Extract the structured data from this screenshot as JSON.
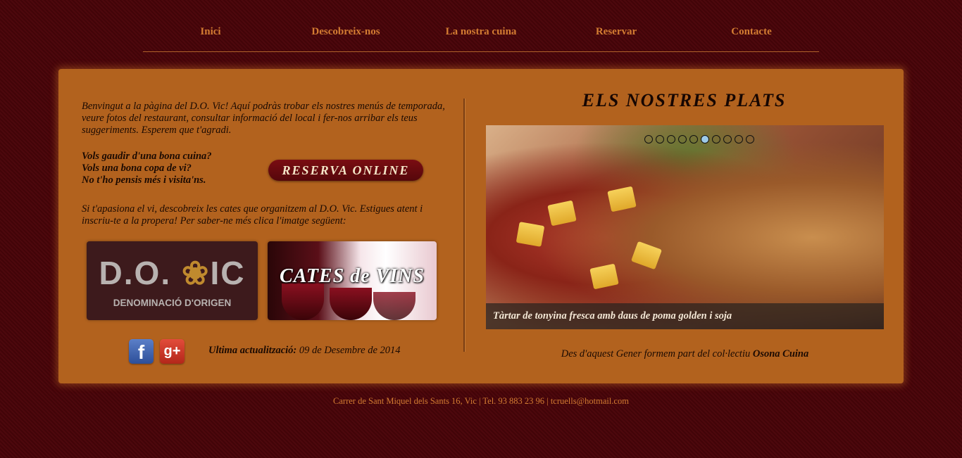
{
  "nav": {
    "items": [
      "Inici",
      "Descobreix-nos",
      "La nostra cuina",
      "Reservar",
      "Contacte"
    ]
  },
  "intro": {
    "text": "Benvingut a la pàgina del D.O. Vic! Aquí podràs trobar els nostres menús de temporada, veure fotos del restaurant, consultar informació del local i fer-nos arribar els teus suggeriments. Esperem que t'agradi."
  },
  "questions": {
    "line1": "Vols gaudir d'una bona cuina?",
    "line2": "Vols una bona copa de vi?",
    "line3": "No t'ho pensis més i visita'ns."
  },
  "reserva_button": {
    "label": "RESERVA ONLINE"
  },
  "cates": {
    "text": "Si t'apasiona el vi, descobreix les cates que organitzem al D.O. Vic. Estigues atent i inscriu-te a la propera! Per saber-ne més clica l'imatge següent:",
    "image_label": "CATES de VINS"
  },
  "logo": {
    "main_prefix": "D.O. ",
    "main_suffix": "IC",
    "sub": "DENOMINACIÓ D'ORIGEN"
  },
  "social": {
    "facebook_glyph": "f",
    "google_glyph": "g+"
  },
  "update": {
    "label": "Ultima actualització:",
    "date": " 09 de Desembre de 2014"
  },
  "plats": {
    "title": "ELS NOSTRES PLATS",
    "caption": "Tàrtar de tonyina fresca amb daus de poma golden i soja",
    "slide_count": 10,
    "active_slide": 5
  },
  "osona": {
    "prefix": "Des d'aquest Gener formem part del col·lectiu ",
    "bold": "Osona Cuina"
  },
  "footer": {
    "text": "Carrer de Sant Miquel dels Sants 16, Vic | Tel. 93 883 23 96 | tcruells@hotmail.com"
  },
  "colors": {
    "background": "#4a0409",
    "panel": "#b2621e",
    "nav_link": "#d37c32"
  }
}
